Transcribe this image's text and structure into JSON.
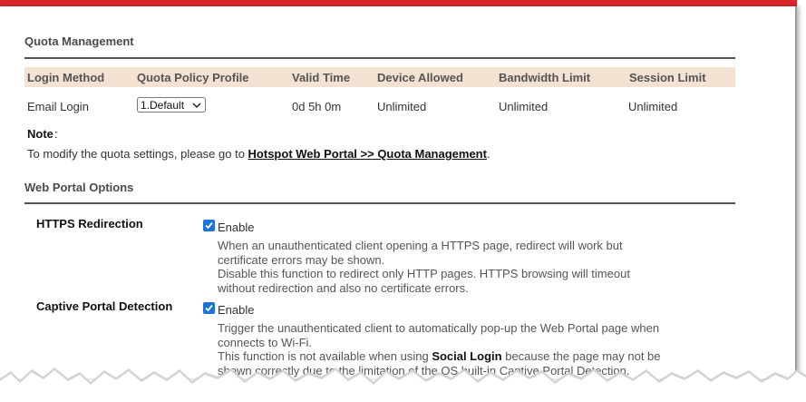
{
  "quota": {
    "section_title": "Quota Management",
    "columns": [
      "Login Method",
      "Quota Policy Profile",
      "Valid Time",
      "Device Allowed",
      "Bandwidth Limit",
      "Session Limit"
    ],
    "row": {
      "login_method": "Email Login",
      "profile_selected": "1.Default",
      "valid_time": "0d 5h 0m",
      "device_allowed": "Unlimited",
      "bandwidth_limit": "Unlimited",
      "session_limit": "Unlimited"
    },
    "note_label": "Note",
    "note_colon": ":",
    "note_prefix": "To modify the quota settings, please go to ",
    "note_link": "Hotspot Web Portal >> Quota Management",
    "note_suffix": "."
  },
  "web_portal": {
    "section_title": "Web Portal Options",
    "https": {
      "label": "HTTPS Redirection",
      "checkbox_label": "Enable",
      "checked": true,
      "desc_1": "When an unauthenticated client opening a HTTPS page, redirect will work but certificate errors may be shown.",
      "desc_2": "Disable this function to redirect only HTTP pages. HTTPS browsing will timeout without redirection and also no certificate errors."
    },
    "captive": {
      "label": "Captive Portal Detection",
      "checkbox_label": "Enable",
      "checked": true,
      "desc_1": "Trigger the unauthenticated client to automatically pop-up the Web Portal page when connects to Wi-Fi.",
      "desc_2_prefix": "This function is not available when using ",
      "desc_2_bold": "Social Login",
      "desc_2_suffix": " because the page may not be shown correctly due to the limitation of the OS built-in Captive Portal Detection."
    }
  },
  "colors": {
    "top_bar": "#d9262b",
    "table_header": "#f3e1d1",
    "checkbox": "#1f72d8"
  }
}
